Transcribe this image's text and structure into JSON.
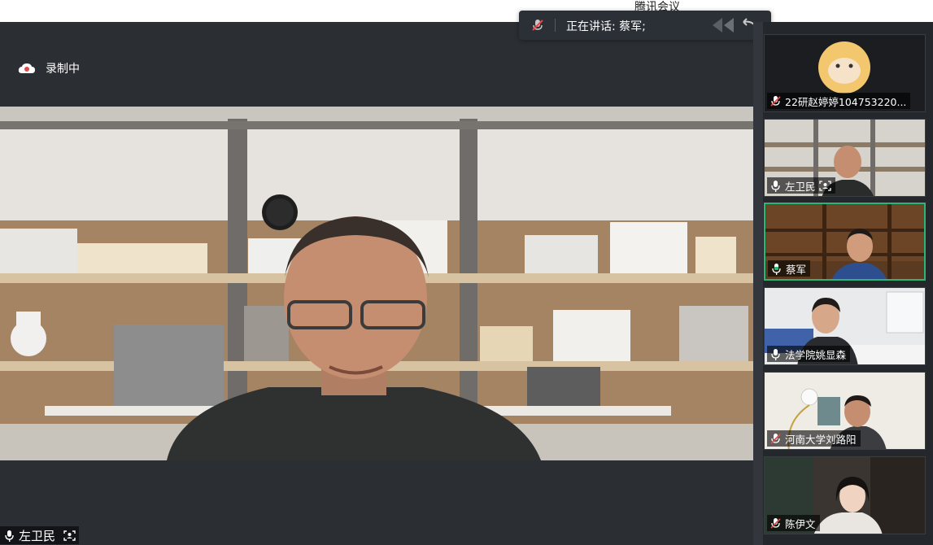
{
  "app": {
    "title": "腾讯会议"
  },
  "speaker_bar": {
    "text": "正在讲话: 蔡军;",
    "mic_icon": "mic-muted-icon"
  },
  "recording": {
    "label": "录制中",
    "icon": "cloud-record-icon"
  },
  "main_video": {
    "name": "左卫民"
  },
  "participants": [
    {
      "name": "22研赵婷婷104753220...",
      "mic": "muted",
      "video": "avatar"
    },
    {
      "name": "左卫民",
      "mic": "on",
      "video": "camera"
    },
    {
      "name": "蔡军",
      "mic": "on",
      "video": "camera",
      "active": true
    },
    {
      "name": "法学院姚显森",
      "mic": "on",
      "video": "camera"
    },
    {
      "name": "河南大学刘路阳",
      "mic": "muted",
      "video": "camera"
    },
    {
      "name": "陈伊文",
      "mic": "muted",
      "video": "camera"
    }
  ],
  "colors": {
    "active_border": "#2bb673",
    "panel_bg": "#2b2e33",
    "mute_red": "#e04a4a"
  }
}
